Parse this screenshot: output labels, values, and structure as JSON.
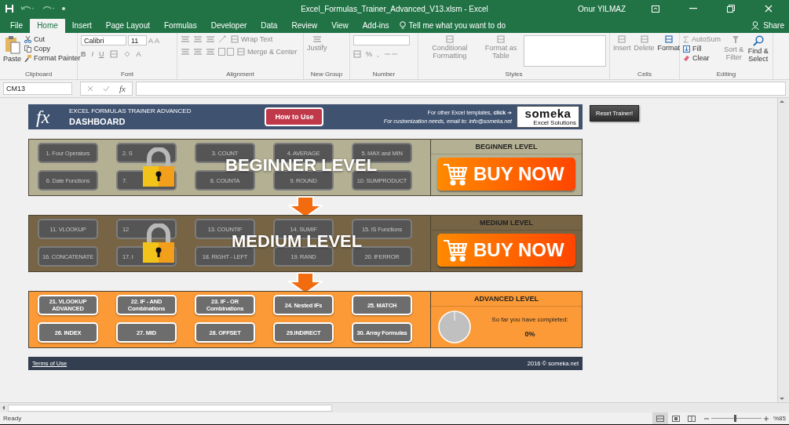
{
  "window": {
    "title": "Excel_Formulas_Trainer_Advanced_V13.xlsm - Excel",
    "user": "Onur YILMAZ"
  },
  "ribbon_tabs": [
    {
      "label": "File",
      "selected": false
    },
    {
      "label": "Home",
      "selected": true
    },
    {
      "label": "Insert",
      "selected": false
    },
    {
      "label": "Page Layout",
      "selected": false
    },
    {
      "label": "Formulas",
      "selected": false
    },
    {
      "label": "Developer",
      "selected": false
    },
    {
      "label": "Data",
      "selected": false
    },
    {
      "label": "Review",
      "selected": false
    },
    {
      "label": "View",
      "selected": false
    },
    {
      "label": "Add-ins",
      "selected": false
    }
  ],
  "tell_me": {
    "placeholder": "Tell me what you want to do"
  },
  "share": "Share",
  "ribbon": {
    "clipboard": {
      "label": "Clipboard",
      "paste": {
        "label": "Paste",
        "disabled": false
      },
      "cut": {
        "label": "Cut",
        "disabled": false
      },
      "copy": {
        "label": "Copy",
        "disabled": false
      },
      "format_painter": {
        "label": "Format Painter",
        "disabled": false
      }
    },
    "font": {
      "label": "Font",
      "family": "Calibri",
      "size": "11",
      "bold": {
        "label": "B",
        "disabled": true
      },
      "italic": {
        "label": "I",
        "disabled": true
      },
      "underline": {
        "label": "U",
        "disabled": true
      },
      "grow": {
        "label": "A",
        "disabled": true
      },
      "shrink": {
        "label": "A",
        "disabled": true
      },
      "font_color": {
        "label": "A",
        "disabled": true
      }
    },
    "alignment": {
      "label": "Alignment",
      "wrap_text": {
        "label": "Wrap Text",
        "disabled": true
      },
      "merge_center": {
        "label": "Merge & Center",
        "disabled": true
      }
    },
    "new_group": {
      "label": "New Group",
      "justify": {
        "label": "Justify",
        "disabled": true
      }
    },
    "number": {
      "label": "Number",
      "percent": {
        "label": "%",
        "disabled": true
      },
      "comma": {
        "label": ",",
        "disabled": true
      }
    },
    "styles": {
      "label": "Styles",
      "conditional_formatting": {
        "label": "Conditional Formatting",
        "disabled": true
      },
      "format_as_table": {
        "label": "Format as Table",
        "disabled": true
      }
    },
    "cells": {
      "label": "Cells",
      "insert": {
        "label": "Insert",
        "disabled": true
      },
      "delete": {
        "label": "Delete",
        "disabled": true
      },
      "format": {
        "label": "Format",
        "disabled": false
      }
    },
    "editing": {
      "label": "Editing",
      "autosum": {
        "label": "AutoSum",
        "disabled": true
      },
      "fill": {
        "label": "Fill",
        "disabled": false
      },
      "clear": {
        "label": "Clear",
        "disabled": false
      },
      "sort_filter": {
        "label": "Sort & Filter",
        "disabled": true
      },
      "find_select": {
        "label": "Find & Select",
        "disabled": false
      }
    }
  },
  "formula_bar": {
    "name_box": "CM13",
    "fx": "fx"
  },
  "dashboard": {
    "logo": "fx",
    "title": "EXCEL FORMULAS TRAINER ADVANCED",
    "subtitle": "DASHBOARD",
    "how_to_use": "How to Use",
    "templates_line": "For other Excel templates, **click** ➔",
    "customization_line": "For customization needs, email to: info@someka.net",
    "brand": "someka",
    "brand_tagline": "Excel Solutions"
  },
  "reset_button": "Reset Trainer!",
  "levels": [
    {
      "title": "BEGINNER LEVEL",
      "overlay": "BEGINNER LEVEL",
      "locked": true,
      "color": "#b4b093",
      "buttons": [
        "1. Four Operators",
        "2. S",
        "3. COUNT",
        "4. AVERAGE",
        "5. MAX and MIN",
        "6. Date Functions",
        "7.",
        "8. COUNTA",
        "9. ROUND",
        "10. SUMPRODUCT"
      ],
      "side": {
        "kind": "buy",
        "label": "BUY NOW"
      }
    },
    {
      "title": "MEDIUM LEVEL",
      "overlay": "MEDIUM LEVEL",
      "locked": true,
      "color": "#766445",
      "buttons": [
        "11. VLOOKUP",
        "12",
        "13. COUNTIF",
        "14. SUMIF",
        "15. IS Functions",
        "16. CONCATENATE",
        "17. I",
        "18. RIGHT - LEFT",
        "19. RAND",
        "20. IFERROR"
      ],
      "side": {
        "kind": "buy",
        "label": "BUY NOW"
      }
    },
    {
      "title": "ADVANCED LEVEL",
      "locked": false,
      "color": "#fb9a36",
      "buttons": [
        "21. VLOOKUP ADVANCED",
        "22. IF - AND Combinations",
        "23. IF - OR Combinations",
        "24. Nested IFs",
        "25. MATCH",
        "26. INDEX",
        "27. MID",
        "28. OFFSET",
        "29.INDIRECT",
        "30. Array Formulas"
      ],
      "side": {
        "kind": "progress",
        "caption": "So far you have completed:",
        "percent": "0%"
      }
    }
  ],
  "footer": {
    "terms": "Terms of Use",
    "copyright": "2016 © someka.net"
  },
  "status_bar": {
    "ready": "Ready",
    "views": [
      {
        "selected": true
      },
      {
        "selected": false
      },
      {
        "selected": false
      }
    ],
    "zoom_slider": {
      "level": 0.45
    },
    "zoom": "%85"
  }
}
